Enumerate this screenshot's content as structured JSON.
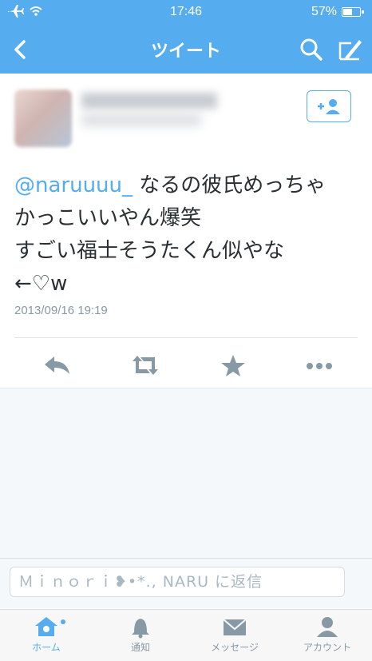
{
  "status_bar": {
    "time": "17:46",
    "battery": "57%",
    "battery_level": 0.57
  },
  "nav": {
    "title": "ツイート"
  },
  "tweet": {
    "mention": "@naruuuu_",
    "line1": " なるの彼氏めっちゃ",
    "line2": "かっこいいやん爆笑",
    "line3": "すごい福士そうたくん似やな",
    "line4": "←♡w",
    "timestamp": "2013/09/16 19:19"
  },
  "follow_button": {
    "label": "+👤"
  },
  "reply": {
    "placeholder": "Ｍｉｎｏｒｉ❥•*., NARU に返信"
  },
  "tabs": [
    {
      "label": "ホーム",
      "icon": "home-icon",
      "active": true
    },
    {
      "label": "通知",
      "icon": "bell-icon",
      "active": false
    },
    {
      "label": "メッセージ",
      "icon": "envelope-icon",
      "active": false
    },
    {
      "label": "アカウント",
      "icon": "person-icon",
      "active": false
    }
  ],
  "colors": {
    "brand": "#55acee",
    "text": "#292f33",
    "muted": "#8899a6"
  }
}
